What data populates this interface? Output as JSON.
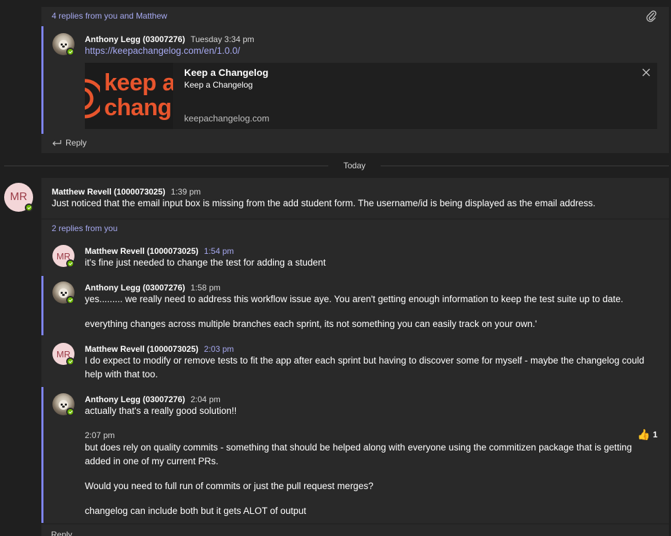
{
  "thread1": {
    "replies_summary": "4 replies from you and Matthew",
    "message": {
      "author": "Anthony Legg (03007276)",
      "time": "Tuesday 3:34 pm",
      "link": "https://keepachangelog.com/en/1.0.0/"
    },
    "preview": {
      "logo_line1": "keep a",
      "logo_line2": "chang",
      "title": "Keep a Changelog",
      "subtitle": "Keep a Changelog",
      "domain": "keepachangelog.com"
    },
    "reply_label": "Reply"
  },
  "today_divider": "Today",
  "thread2": {
    "root": {
      "initials": "MR",
      "author": "Matthew Revell (1000073025)",
      "time": "1:39 pm",
      "text": "Just noticed that the email input box is missing from the add student form. The username/id is being displayed as the email address."
    },
    "replies_summary": "2 replies from you",
    "replies": [
      {
        "initials": "MR",
        "author": "Matthew Revell (1000073025)",
        "time": "1:54 pm",
        "text": "it's fine just needed to change the test for adding a student"
      },
      {
        "author": "Anthony Legg (03007276)",
        "time": "1:58 pm",
        "text1": "yes......... we really need to address this workflow issue aye. You aren't getting enough information to keep the test suite up to date.",
        "text2": "everything changes across multiple branches each sprint, its not something you can easily track on your own.'"
      },
      {
        "initials": "MR",
        "author": "Matthew Revell (1000073025)",
        "time": "2:03 pm",
        "text": "I do expect to modify or remove tests to fit the app after each sprint but having to discover some for myself - maybe the changelog could help with that too."
      },
      {
        "author": "Anthony Legg (03007276)",
        "time": "2:04 pm",
        "text": "actually that's a really good solution!!",
        "followup_time": "2:07 pm",
        "followup1": "but does rely on quality commits - something that should be helped along with everyone using the commitizen package that is getting added in one of my current PRs.",
        "followup2": "Would you need to full run of commits or just the pull request merges?",
        "followup3": "changelog can include both but it gets ALOT of output",
        "reaction_count": "1"
      }
    ],
    "reply_label": "Reply"
  },
  "colors": {
    "accent": "#7f85f5",
    "presence": "#6bb700",
    "logo": "#e8552d"
  }
}
